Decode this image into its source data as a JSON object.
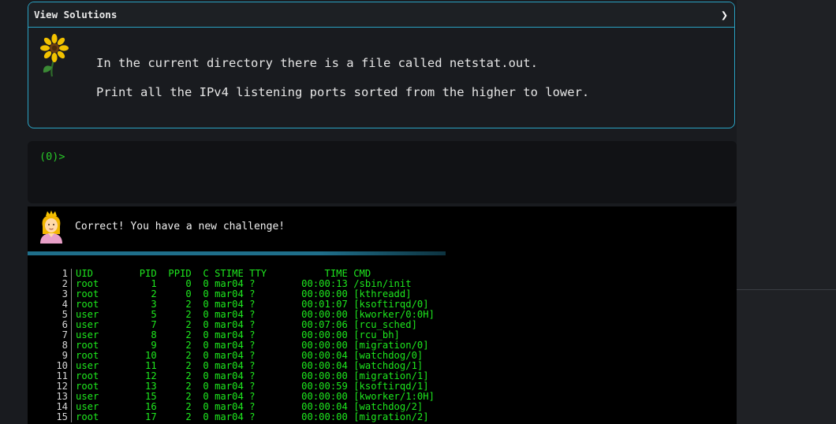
{
  "challenge": {
    "header_title": "View Solutions",
    "line1": "In the current directory there is a file called netstat.out.",
    "line2": "Print all the IPv4 listening ports sorted from the higher to lower."
  },
  "prompt": {
    "text": "(0)>"
  },
  "result": {
    "message": "Correct! You have a new challenge!"
  },
  "output": {
    "lines": [
      {
        "n": "1",
        "text": "UID        PID  PPID  C STIME TTY          TIME CMD"
      },
      {
        "n": "2",
        "text": "root         1     0  0 mar04 ?        00:00:13 /sbin/init"
      },
      {
        "n": "3",
        "text": "root         2     0  0 mar04 ?        00:00:00 [kthreadd]"
      },
      {
        "n": "4",
        "text": "root         3     2  0 mar04 ?        00:01:07 [ksoftirqd/0]"
      },
      {
        "n": "5",
        "text": "user         5     2  0 mar04 ?        00:00:00 [kworker/0:0H]"
      },
      {
        "n": "6",
        "text": "user         7     2  0 mar04 ?        00:07:06 [rcu_sched]"
      },
      {
        "n": "7",
        "text": "user         8     2  0 mar04 ?        00:00:00 [rcu_bh]"
      },
      {
        "n": "8",
        "text": "root         9     2  0 mar04 ?        00:00:00 [migration/0]"
      },
      {
        "n": "9",
        "text": "root        10     2  0 mar04 ?        00:00:04 [watchdog/0]"
      },
      {
        "n": "10",
        "text": "user        11     2  0 mar04 ?        00:00:04 [watchdog/1]"
      },
      {
        "n": "11",
        "text": "root        12     2  0 mar04 ?        00:00:00 [migration/1]"
      },
      {
        "n": "12",
        "text": "root        13     2  0 mar04 ?        00:00:59 [ksoftirqd/1]"
      },
      {
        "n": "13",
        "text": "user        15     2  0 mar04 ?        00:00:00 [kworker/1:0H]"
      },
      {
        "n": "14",
        "text": "user        16     2  0 mar04 ?        00:00:04 [watchdog/2]"
      },
      {
        "n": "15",
        "text": "root        17     2  0 mar04 ?        00:00:00 [migration/2]"
      }
    ]
  },
  "icons": {
    "challenge_icon": "sunflower-icon",
    "result_icon": "princess-icon",
    "header_icon": "chevron-right-icon"
  },
  "colors": {
    "accent_border": "#2aa3c4",
    "prompt_green": "#28c828",
    "output_green": "#1ee81e",
    "background": "#191b1f"
  }
}
